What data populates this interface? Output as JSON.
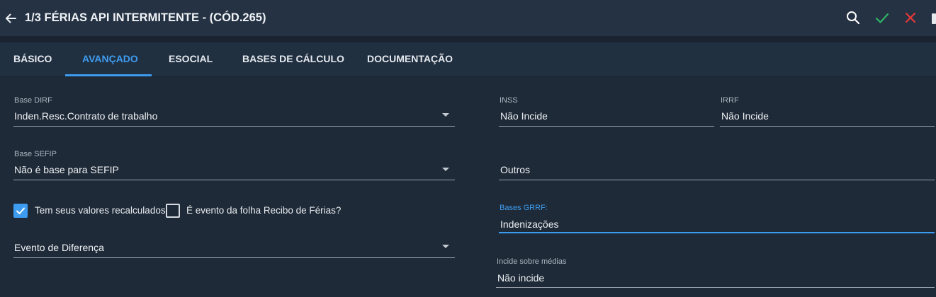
{
  "header": {
    "title": "1/3 FÉRIAS API INTERMITENTE - (CÓD.265)",
    "icons": [
      "arrow-left-icon",
      "search-icon",
      "check-icon",
      "close-icon"
    ],
    "colors": {
      "confirm": "#2fb566",
      "cancel": "#e53935"
    }
  },
  "tabs": [
    {
      "label": "BÁSICO",
      "active": false
    },
    {
      "label": "AVANÇADO",
      "active": true
    },
    {
      "label": "ESOCIAL",
      "active": false
    },
    {
      "label": "BASES DE CÁLCULO",
      "active": false
    },
    {
      "label": "DOCUMENTAÇÃO",
      "active": false
    }
  ],
  "left": {
    "base_dirf": {
      "label": "Base DIRF",
      "value": "Inden.Resc.Contrato de trabalho"
    },
    "base_sefip": {
      "label": "Base SEFIP",
      "value": "Não é base para SEFIP"
    },
    "recalculados": {
      "label": "Tem seus valores recalculados",
      "checked": true
    },
    "recibo_ferias": {
      "label": "É evento da folha Recibo de Férias?",
      "checked": false
    },
    "evento_diferenca": {
      "value": "Evento de Diferença"
    }
  },
  "right": {
    "inss": {
      "label": "INSS",
      "value": "Não Incide"
    },
    "irrf": {
      "label": "IRRF",
      "value": "Não Incide"
    },
    "outros": {
      "value": "Outros"
    },
    "bases_grrf": {
      "label": "Bases GRRF:",
      "value": "Indenizações"
    },
    "incide_medias": {
      "label": "Incide sobre médias",
      "value": "Não incide"
    }
  },
  "accent_color": "#3d9cf0"
}
